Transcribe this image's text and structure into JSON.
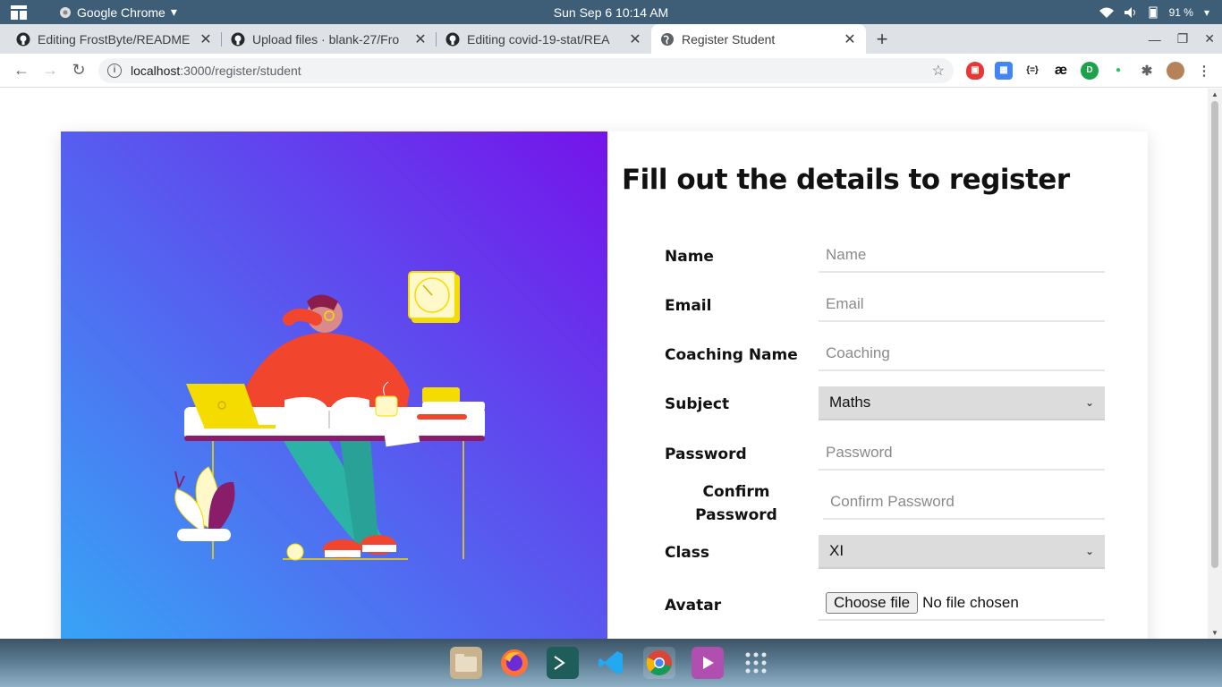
{
  "system": {
    "app_name": "Google Chrome",
    "clock": "Sun Sep 6  10:14 AM",
    "battery": "91 %"
  },
  "tabs": [
    {
      "title": "Editing FrostByte/README",
      "icon": "github-icon"
    },
    {
      "title": "Upload files · blank-27/Fro",
      "icon": "github-icon"
    },
    {
      "title": "Editing covid-19-stat/REA",
      "icon": "github-icon"
    },
    {
      "title": "Register Student",
      "icon": "globe-icon",
      "active": true
    }
  ],
  "address_bar": {
    "host": "localhost",
    "path": ":3000/register/student"
  },
  "form": {
    "title": "Fill out the details to register",
    "fields": {
      "name": {
        "label": "Name",
        "placeholder": "Name"
      },
      "email": {
        "label": "Email",
        "placeholder": "Email"
      },
      "coaching": {
        "label": "Coaching Name",
        "placeholder": "Coaching"
      },
      "subject": {
        "label": "Subject",
        "value": "Maths"
      },
      "password": {
        "label": "Password",
        "placeholder": "Password"
      },
      "confirm": {
        "label_line1": "Confirm",
        "label_line2": "Password",
        "placeholder": "Confirm Password"
      },
      "class": {
        "label": "Class",
        "value": "XI"
      },
      "avatar": {
        "label": "Avatar",
        "button": "Choose file",
        "status": "No file chosen"
      }
    }
  },
  "colors": {
    "gradient_start": "#36a8f6",
    "gradient_end": "#7513ea"
  }
}
